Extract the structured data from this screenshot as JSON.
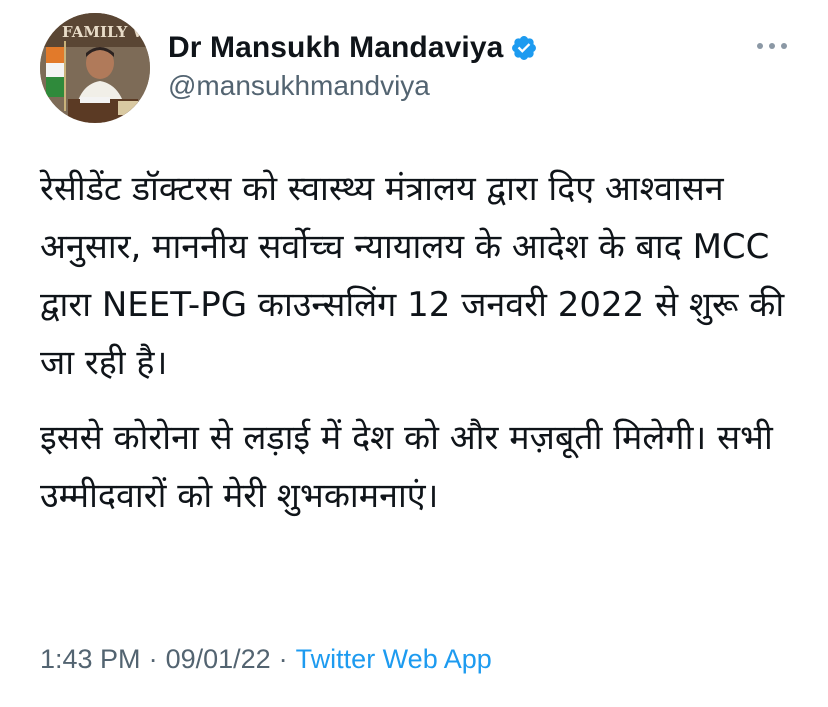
{
  "tweet": {
    "author": {
      "display_name": "Dr Mansukh Mandaviya",
      "handle": "@mansukhmandviya",
      "verified": true,
      "avatar_sign_text": "FAMILY W"
    },
    "paragraphs": [
      "रेसीडेंट डॉक्टरस को स्वास्थ्य मंत्रालय द्वारा दिए आश्वासन अनुसार, माननीय सर्वोच्च न्यायालय के आदेश के बाद MCC द्वारा NEET-PG काउन्सलिंग 12 जनवरी 2022 से शुरू की जा रही है।",
      "इससे कोरोना से लड़ाई में देश को और मज़बूती मिलेगी। सभी उम्मीदवारों को मेरी शुभकामनाएं।"
    ],
    "time": "1:43 PM",
    "date": "09/01/22",
    "separator": "·",
    "source": "Twitter Web App"
  },
  "icons": {
    "verified": "verified-badge-icon",
    "more": "more-options-icon"
  },
  "colors": {
    "text_primary": "#0f1419",
    "text_secondary": "#536471",
    "accent": "#1d9bf0",
    "background": "#ffffff"
  }
}
